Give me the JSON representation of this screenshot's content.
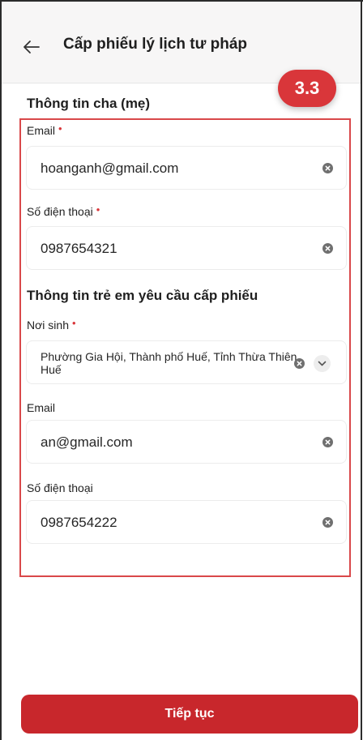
{
  "header": {
    "title": "Cấp phiếu lý lịch tư pháp"
  },
  "badge": "3.3",
  "parent_section": {
    "title": "Thông tin cha (mẹ)",
    "email_label": "Email",
    "email_value": "hoanganh@gmail.com",
    "phone_label": "Số điện thoại",
    "phone_value": "0987654321"
  },
  "child_section": {
    "title": "Thông tin trẻ em yêu cầu cấp phiếu",
    "birthplace_label": "Nơi sinh",
    "birthplace_value": "Phường Gia Hội, Thành phố Huế, Tỉnh Thừa Thiên Huế",
    "email_label": "Email",
    "email_value": "an@gmail.com",
    "phone_label": "Số điện thoại",
    "phone_value": "0987654222"
  },
  "required_marker": "•",
  "footer": {
    "continue_label": "Tiếp tục"
  },
  "colors": {
    "accent": "#c8272c",
    "badge": "#d9363a",
    "highlight": "#d9484a"
  }
}
